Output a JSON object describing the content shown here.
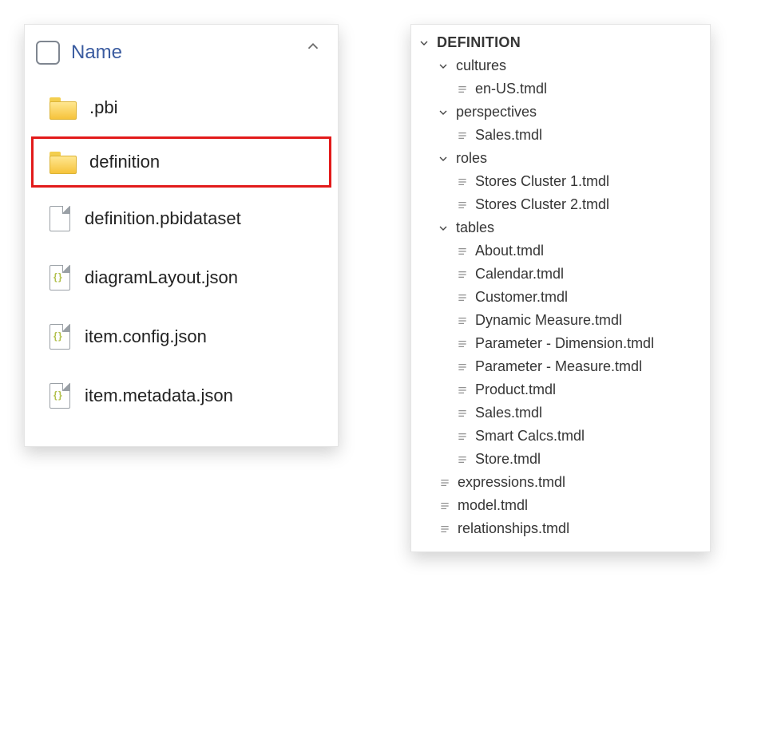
{
  "explorer": {
    "column_header": "Name",
    "items": [
      {
        "name": ".pbi",
        "kind": "folder",
        "highlight": false
      },
      {
        "name": "definition",
        "kind": "folder",
        "highlight": true
      },
      {
        "name": "definition.pbidataset",
        "kind": "file",
        "highlight": false
      },
      {
        "name": "diagramLayout.json",
        "kind": "json",
        "highlight": false
      },
      {
        "name": "item.config.json",
        "kind": "json",
        "highlight": false
      },
      {
        "name": "item.metadata.json",
        "kind": "json",
        "highlight": false
      }
    ]
  },
  "tree": {
    "root": "DEFINITION",
    "folders": [
      {
        "name": "cultures",
        "files": [
          "en-US.tmdl"
        ]
      },
      {
        "name": "perspectives",
        "files": [
          "Sales.tmdl"
        ]
      },
      {
        "name": "roles",
        "files": [
          "Stores Cluster 1.tmdl",
          "Stores Cluster 2.tmdl"
        ]
      },
      {
        "name": "tables",
        "files": [
          "About.tmdl",
          "Calendar.tmdl",
          "Customer.tmdl",
          "Dynamic Measure.tmdl",
          "Parameter - Dimension.tmdl",
          "Parameter - Measure.tmdl",
          "Product.tmdl",
          "Sales.tmdl",
          "Smart Calcs.tmdl",
          "Store.tmdl"
        ]
      }
    ],
    "root_files": [
      "expressions.tmdl",
      "model.tmdl",
      "relationships.tmdl"
    ]
  }
}
